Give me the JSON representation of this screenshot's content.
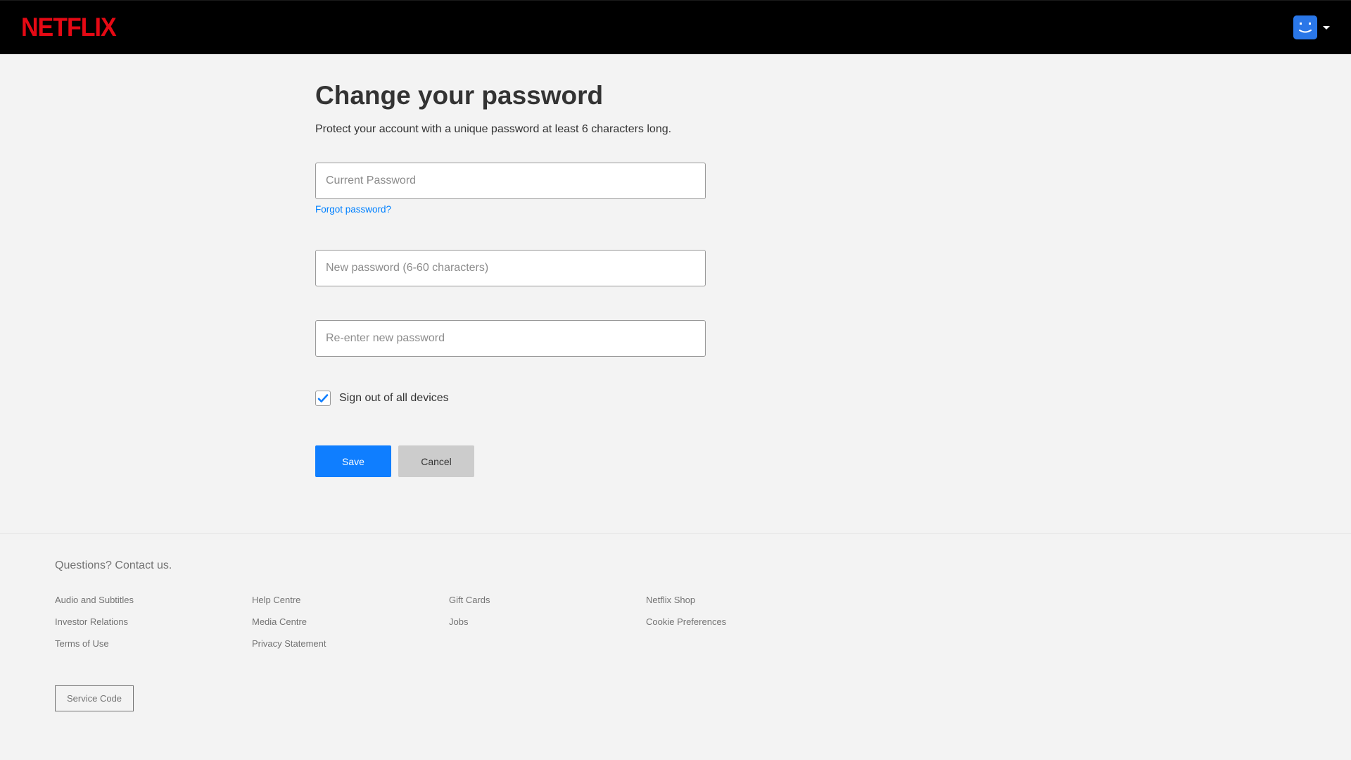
{
  "header": {
    "logo_text": "NETFLIX"
  },
  "page": {
    "title": "Change your password",
    "subtitle": "Protect your account with a unique password at least 6 characters long."
  },
  "form": {
    "current_password": {
      "placeholder": "Current Password",
      "value": ""
    },
    "forgot_link": "Forgot password?",
    "new_password": {
      "placeholder": "New password (6-60 characters)",
      "value": ""
    },
    "confirm_password": {
      "placeholder": "Re-enter new password",
      "value": ""
    },
    "signout_checkbox": {
      "label": "Sign out of all devices",
      "checked": true
    },
    "save_button": "Save",
    "cancel_button": "Cancel"
  },
  "footer": {
    "contact": "Questions? Contact us.",
    "links": [
      "Audio and Subtitles",
      "Help Centre",
      "Gift Cards",
      "Netflix Shop",
      "Investor Relations",
      "Media Centre",
      "Jobs",
      "Cookie Preferences",
      "Terms of Use",
      "Privacy Statement"
    ],
    "service_code": "Service Code"
  }
}
